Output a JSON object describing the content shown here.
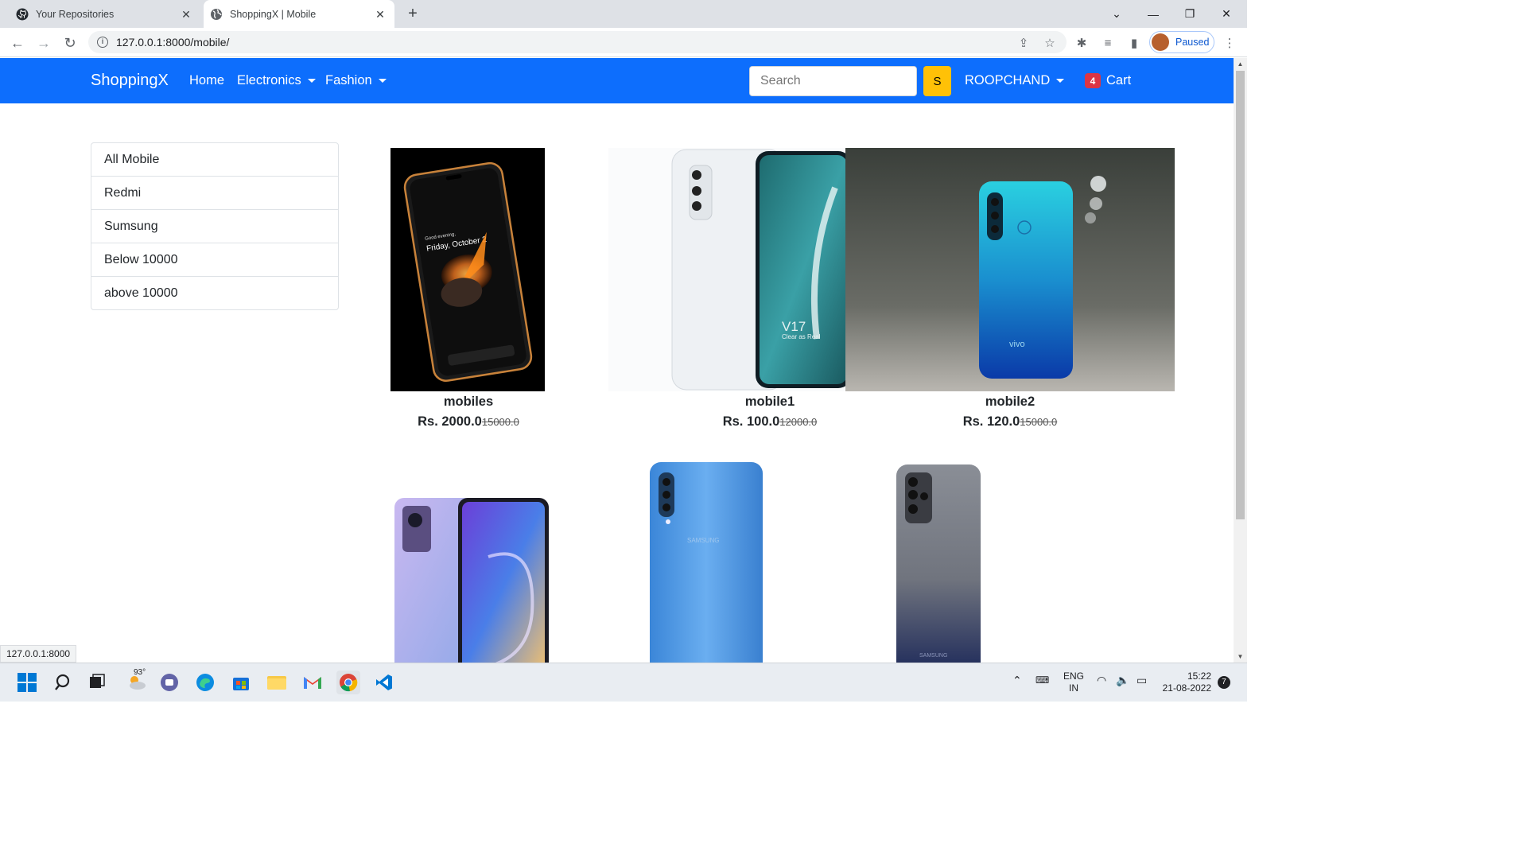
{
  "browser": {
    "tabs": [
      {
        "title": "Your Repositories",
        "icon": "github-icon"
      },
      {
        "title": "ShoppingX | Mobile",
        "icon": "globe-icon"
      }
    ],
    "url": "127.0.0.1:8000/mobile/",
    "profile_label": "Paused",
    "status_url": "127.0.0.1:8000"
  },
  "navbar": {
    "brand": "ShoppingX",
    "links": [
      "Home",
      "Electronics",
      "Fashion"
    ],
    "search_placeholder": "Search",
    "search_button": "S",
    "user": "ROOPCHAND",
    "cart_count": "4",
    "cart_label": "Cart",
    "color": "#0d6efd"
  },
  "sidebar": {
    "items": [
      "All Mobile",
      "Redmi",
      "Sumsung",
      "Below 10000",
      "above 10000"
    ]
  },
  "products": [
    {
      "name": "mobiles",
      "price": "Rs. 2000.0",
      "mrp": "15000.0"
    },
    {
      "name": "mobile1",
      "price": "Rs. 100.0",
      "mrp": "12000.0"
    },
    {
      "name": "mobile2",
      "price": "Rs. 120.0",
      "mrp": "15000.0"
    }
  ],
  "image_text": {
    "phone1_greeting": "Good evening,",
    "phone1_date": "Friday, October 2",
    "phone2_model": "V17",
    "phone2_tag": "Clear as Real",
    "phone3_brand": "vivo",
    "phone5_brand": "SAMSUNG",
    "phone6_brand": "SAMSUNG"
  },
  "taskbar": {
    "weather": "93°",
    "lang1": "ENG",
    "lang2": "IN",
    "time": "15:22",
    "date": "21-08-2022",
    "notifications": "7"
  }
}
